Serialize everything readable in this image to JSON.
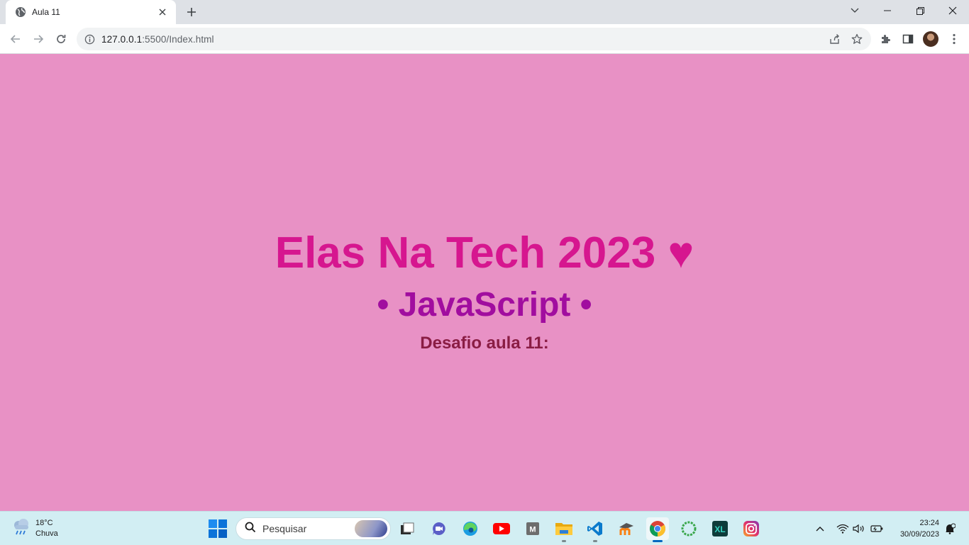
{
  "browser": {
    "tab": {
      "title": "Aula 11"
    },
    "omnibox": {
      "host": "127.0.0.1",
      "rest": ":5500/Index.html"
    }
  },
  "page": {
    "heading": "Elas Na Tech 2023 ♥",
    "subheading": "• JavaScript •",
    "subtitle": "Desafio aula 11:",
    "background_color": "#e891c5",
    "heading_color": "#d6168f",
    "subheading_color": "#a10d9f",
    "subtitle_color": "#8a1d44"
  },
  "taskbar": {
    "weather": {
      "temp": "18°C",
      "condition": "Chuva"
    },
    "search_placeholder": "Pesquisar",
    "apps": [
      "task-view-icon",
      "teams-chat-icon",
      "edge-icon",
      "youtube-icon",
      "m-app-icon",
      "file-explorer-icon",
      "vscode-icon",
      "moodle-icon",
      "chrome-icon",
      "circle-app-icon",
      "xl-app-icon",
      "instagram-icon"
    ],
    "clock": {
      "time": "23:24",
      "date": "30/09/2023"
    }
  }
}
